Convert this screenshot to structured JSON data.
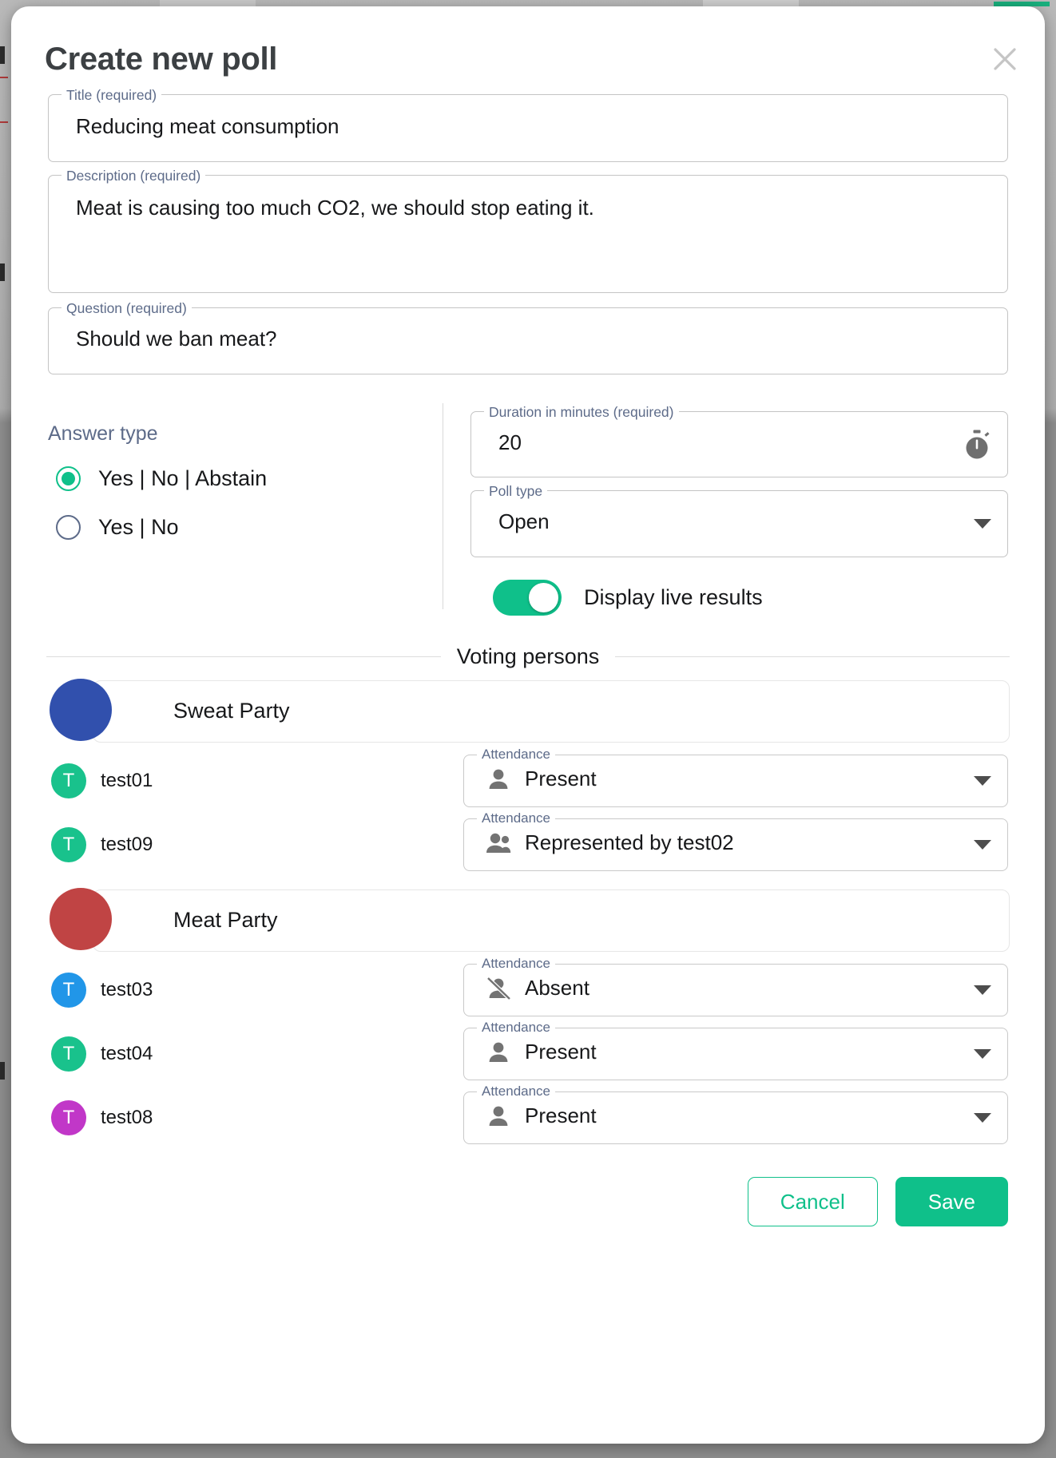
{
  "dialog": {
    "title": "Create new poll",
    "close_icon": "close-icon"
  },
  "form": {
    "title": {
      "label": "Title (required)",
      "value": "Reducing meat consumption"
    },
    "description": {
      "label": "Description (required)",
      "value": "Meat is causing too much CO2, we should stop eating it."
    },
    "question": {
      "label": "Question (required)",
      "value": "Should we ban meat?"
    },
    "answer_type": {
      "label": "Answer type",
      "options": [
        {
          "label": "Yes | No | Abstain",
          "selected": true
        },
        {
          "label": "Yes | No",
          "selected": false
        }
      ]
    },
    "duration": {
      "label": "Duration in minutes (required)",
      "value": "20",
      "icon": "stopwatch-icon"
    },
    "poll_type": {
      "label": "Poll type",
      "value": "Open",
      "icon": "chevron-down-icon"
    },
    "live_results": {
      "label": "Display live results",
      "on": true
    }
  },
  "voting_persons": {
    "section_label": "Voting persons",
    "parties": [
      {
        "name": "Sweat Party",
        "color": "#3150ad",
        "members": [
          {
            "initial": "T",
            "name": "test01",
            "avatar_color": "#19c28c",
            "attendance": {
              "label": "Attendance",
              "value": "Present",
              "icon": "person-icon"
            }
          },
          {
            "initial": "T",
            "name": "test09",
            "avatar_color": "#19c28c",
            "attendance": {
              "label": "Attendance",
              "value": "Represented by test02",
              "icon": "people-icon"
            }
          }
        ]
      },
      {
        "name": "Meat Party",
        "color": "#c04444",
        "members": [
          {
            "initial": "T",
            "name": "test03",
            "avatar_color": "#2196e8",
            "attendance": {
              "label": "Attendance",
              "value": "Absent",
              "icon": "person-off-icon"
            }
          },
          {
            "initial": "T",
            "name": "test04",
            "avatar_color": "#19c28c",
            "attendance": {
              "label": "Attendance",
              "value": "Present",
              "icon": "person-icon"
            }
          },
          {
            "initial": "T",
            "name": "test08",
            "avatar_color": "#c137c8",
            "attendance": {
              "label": "Attendance",
              "value": "Present",
              "icon": "person-icon"
            }
          }
        ]
      }
    ]
  },
  "footer": {
    "cancel_label": "Cancel",
    "save_label": "Save"
  },
  "colors": {
    "accent_green": "#0fc08a",
    "label_blue_grey": "#5d6b89"
  }
}
